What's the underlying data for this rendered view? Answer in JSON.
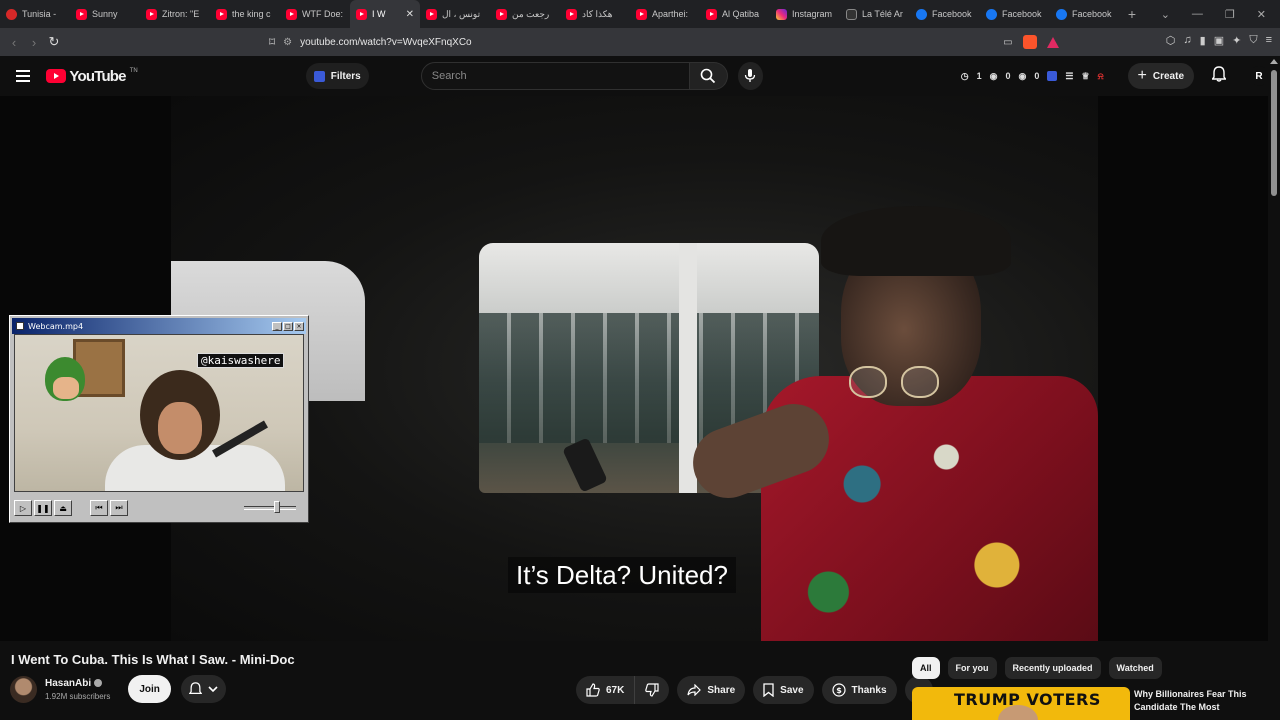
{
  "browser": {
    "tabs": [
      {
        "label": "Tunisia - ",
        "icon": "tunisia-flag-icon"
      },
      {
        "label": "Sunny",
        "icon": "youtube-muted-icon"
      },
      {
        "label": "Zitron: \"E",
        "icon": "youtube-icon"
      },
      {
        "label": "the king c",
        "icon": "youtube-icon"
      },
      {
        "label": "WTF Doe:",
        "icon": "youtube-icon"
      },
      {
        "label": "I W",
        "icon": "youtube-audio-icon",
        "active": true
      },
      {
        "label": "تونس ، ال",
        "icon": "youtube-icon"
      },
      {
        "label": "رجعت من",
        "icon": "youtube-icon"
      },
      {
        "label": "هكذا كاد",
        "icon": "youtube-icon"
      },
      {
        "label": "Aparthei:",
        "icon": "youtube-icon"
      },
      {
        "label": "Al Qatiba",
        "icon": "youtube-icon"
      },
      {
        "label": "Instagram",
        "icon": "instagram-icon"
      },
      {
        "label": "La Télé Ar",
        "icon": "tv-icon"
      },
      {
        "label": "Facebook",
        "icon": "facebook-icon"
      },
      {
        "label": "Facebook",
        "icon": "facebook-icon"
      },
      {
        "label": "Facebook",
        "icon": "facebook-icon"
      }
    ],
    "url": "youtube.com/watch?v=WvqeXFnqXCo"
  },
  "youtube": {
    "logo_text": "YouTube",
    "logo_tm": "TN",
    "filters_label": "Filters",
    "search_placeholder": "Search",
    "stats": {
      "a": "1",
      "b": "0",
      "c": "0"
    },
    "create_label": "Create",
    "avatar_letter": "R"
  },
  "video": {
    "subtitle": "It’s Delta? United?",
    "title": "I Went To Cuba. This Is What I Saw. - Mini-Doc"
  },
  "webcam": {
    "title": "Webcam.mp4",
    "handle": "@kaiswashere"
  },
  "channel": {
    "name": "HasanAbi",
    "subscribers": "1.92M subscribers",
    "join_label": "Join"
  },
  "actions": {
    "likes": "67K",
    "share": "Share",
    "save": "Save",
    "thanks": "Thanks"
  },
  "chips": [
    "All",
    "For you",
    "Recently uploaded",
    "Watched"
  ],
  "recommendation": {
    "thumb_text": "TRUMP VOTERS",
    "title": "Why Billionaires Fear This Candidate The Most"
  },
  "colors": {
    "accent": "#ff0033",
    "background": "#0f0f0f"
  }
}
